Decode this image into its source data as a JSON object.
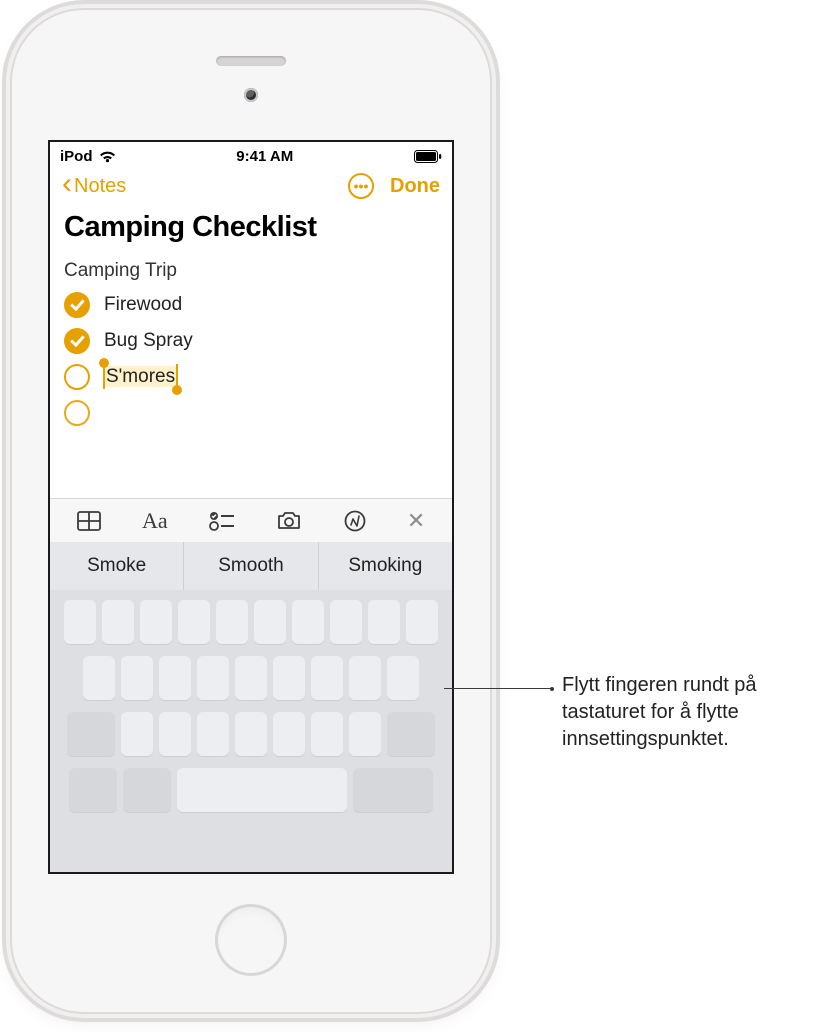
{
  "status": {
    "carrier": "iPod",
    "time": "9:41 AM"
  },
  "nav": {
    "back_label": "Notes",
    "done_label": "Done"
  },
  "note": {
    "title": "Camping Checklist",
    "subtitle": "Camping Trip",
    "items": [
      {
        "label": "Firewood",
        "checked": true
      },
      {
        "label": "Bug Spray",
        "checked": true
      },
      {
        "label": "S'mores",
        "checked": false,
        "selected": true
      }
    ]
  },
  "suggestions": [
    "Smoke",
    "Smooth",
    "Smoking"
  ],
  "toolbar_icons": [
    "table-icon",
    "text-format-icon",
    "checklist-icon",
    "camera-icon",
    "markup-icon",
    "close-icon"
  ],
  "callout": "Flytt fingeren rundt på tastaturet for å flytte innsettingspunktet."
}
